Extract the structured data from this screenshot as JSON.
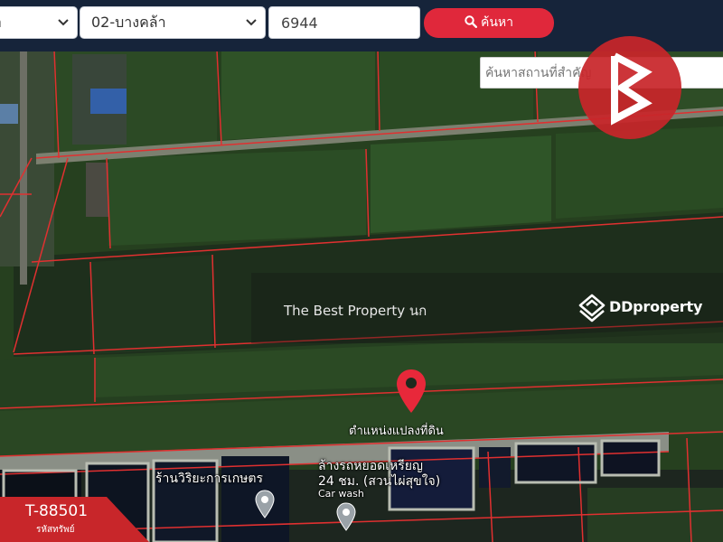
{
  "search_bar": {
    "province_value": "า",
    "district_value": "02-บางคล้า",
    "code_value": "6944",
    "search_button_label": "ค้นหา"
  },
  "map": {
    "place_search_placeholder": "ค้นหาสถานที่สำคัญ",
    "land_marker_label": "ตำแหน่งแปลงที่ดิน",
    "pois": [
      {
        "label": "ร้านวิริยะการเกษตร"
      },
      {
        "label": "ล้างรถหยอดเหรียญ",
        "label_line2": "24 ชม. (สวนไผ่สุขใจ)",
        "label_line3": "Car wash"
      }
    ]
  },
  "watermark": {
    "text": "The Best Property นก",
    "brand": "DDproperty"
  },
  "property_tag": {
    "code": "T-88501",
    "caption": "รหัสทรัพย์"
  },
  "colors": {
    "topbar": "#16243a",
    "search_button": "#e0283b",
    "brand_logo": "#c8262a",
    "parcel_lines": "#e03030",
    "marker": "#e8283a"
  },
  "icons": {
    "search": "search-icon",
    "chevron": "chevron-down-icon",
    "land_marker": "map-pin-icon",
    "poi": "place-pin-icon",
    "brand": "brand-logo-icon",
    "ddproperty": "ddproperty-logo-icon"
  }
}
